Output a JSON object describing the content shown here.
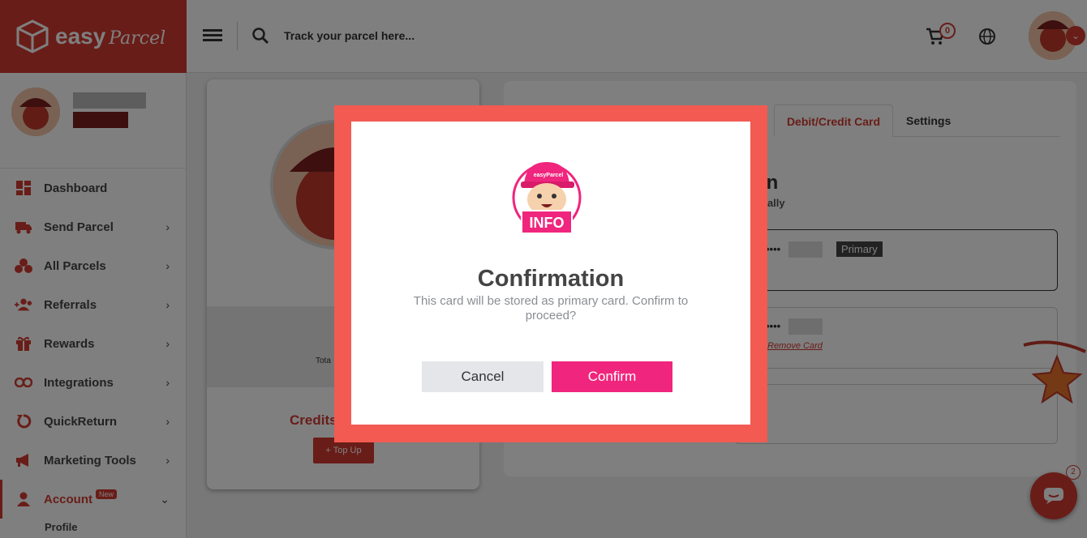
{
  "header": {
    "logo_text": "easy",
    "logo_script": "Parcel",
    "search_placeholder": "Track your parcel here...",
    "cart_count": "0",
    "accent_color": "#d33a30"
  },
  "sidebar": {
    "items": [
      {
        "label": "Dashboard",
        "icon": "dashboard-icon"
      },
      {
        "label": "Send Parcel",
        "icon": "truck-icon"
      },
      {
        "label": "All Parcels",
        "icon": "parcels-icon"
      },
      {
        "label": "Referrals",
        "icon": "referrals-icon"
      },
      {
        "label": "Rewards",
        "icon": "gift-icon"
      },
      {
        "label": "Integrations",
        "icon": "link-icon"
      },
      {
        "label": "QuickReturn",
        "icon": "return-icon"
      },
      {
        "label": "Marketing Tools",
        "icon": "megaphone-icon"
      },
      {
        "label": "Account",
        "icon": "user-icon",
        "badge": "New"
      }
    ],
    "sub_item": "Profile"
  },
  "profile_card": {
    "total_label": "Tota",
    "credits_label": "Credits",
    "topup_label": "+ Top Up"
  },
  "tabs": {
    "active": "Debit/Credit Card",
    "settings": "Settings"
  },
  "payment": {
    "title_partial": "on",
    "subtitle_partial": "nally",
    "card1_mask": "••••",
    "card1_badge": "Primary",
    "card2_mask": "••••",
    "remove_card": "Remove Card"
  },
  "modal": {
    "mascot_sign": "INFO",
    "mascot_cap": "easyParcel",
    "title": "Confirmation",
    "message": "This card will be stored as primary card. Confirm to proceed?",
    "cancel_label": "Cancel",
    "confirm_label": "Confirm",
    "confirm_color": "#f0257d"
  },
  "chat": {
    "badge_count": "2"
  }
}
